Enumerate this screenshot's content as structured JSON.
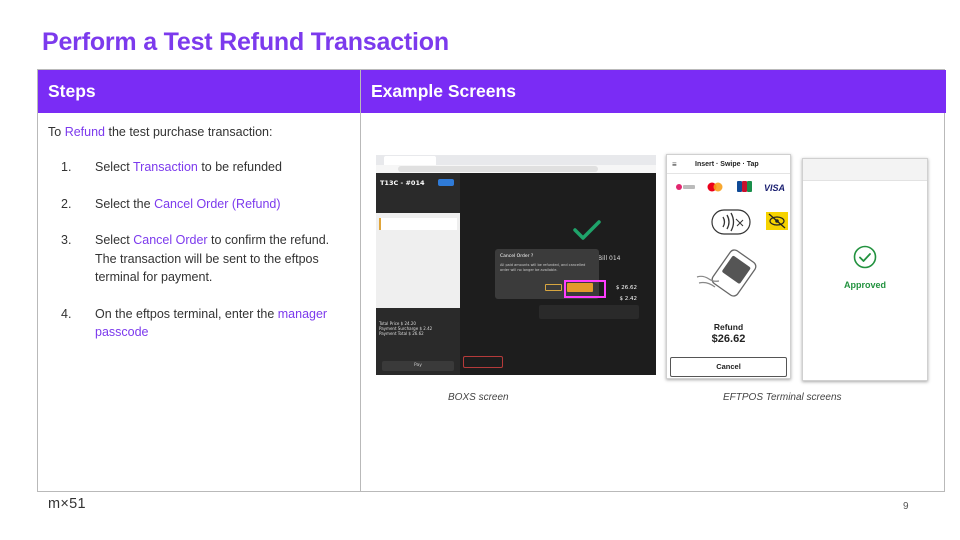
{
  "title": "Perform a Test Refund Transaction",
  "headers": {
    "steps": "Steps",
    "examples": "Example Screens"
  },
  "intro": {
    "pre": "To ",
    "hl": "Refund",
    "post": " the test purchase transaction:"
  },
  "steps": [
    {
      "num": "1.",
      "parts": [
        {
          "t": "Select ",
          "h": false
        },
        {
          "t": "Transaction",
          "h": true
        },
        {
          "t": " to be refunded",
          "h": false
        }
      ]
    },
    {
      "num": "2.",
      "parts": [
        {
          "t": "Select the ",
          "h": false
        },
        {
          "t": "Cancel Order (Refund)",
          "h": true
        }
      ]
    },
    {
      "num": "3.",
      "parts": [
        {
          "t": "Select ",
          "h": false
        },
        {
          "t": "Cancel Order",
          "h": true
        },
        {
          "t": " to confirm the refund. The transaction will be sent to the eftpos terminal for payment.",
          "h": false
        }
      ]
    },
    {
      "num": "4.",
      "parts": [
        {
          "t": "On the eftpos terminal, enter the ",
          "h": false
        },
        {
          "t": "manager passcode",
          "h": true
        }
      ]
    }
  ],
  "boxs": {
    "order_title": "T13C - #014",
    "dialog_title": "Cancel Order ?",
    "dialog_text": "All paid amounts will be refunded, and cancelled order will no longer be available.",
    "bill_label": "Bill 014",
    "amount_1": "$ 26.62",
    "amount_2": "$ 2.42",
    "pay_label": "Pay",
    "totals": [
      "Total Price $ 24.20",
      "Payment Surcharge $ 2.42",
      "Payment Total $ 26.62"
    ]
  },
  "captions": {
    "boxs": "BOXS screen",
    "eftpos": "EFTPOS Terminal screens"
  },
  "eftpos1": {
    "title": "Insert · Swipe · Tap",
    "menu_icon": "≡",
    "refund_label": "Refund",
    "refund_amount": "$26.62",
    "cancel_label": "Cancel"
  },
  "eftpos2": {
    "status": "Approved"
  },
  "footer": {
    "logo": "m×51",
    "page": "9"
  },
  "colors": {
    "accent": "#7c3aed",
    "header_bg": "#7a2cf5",
    "approved": "#22923f",
    "highlight_box": "#ff3dff"
  }
}
